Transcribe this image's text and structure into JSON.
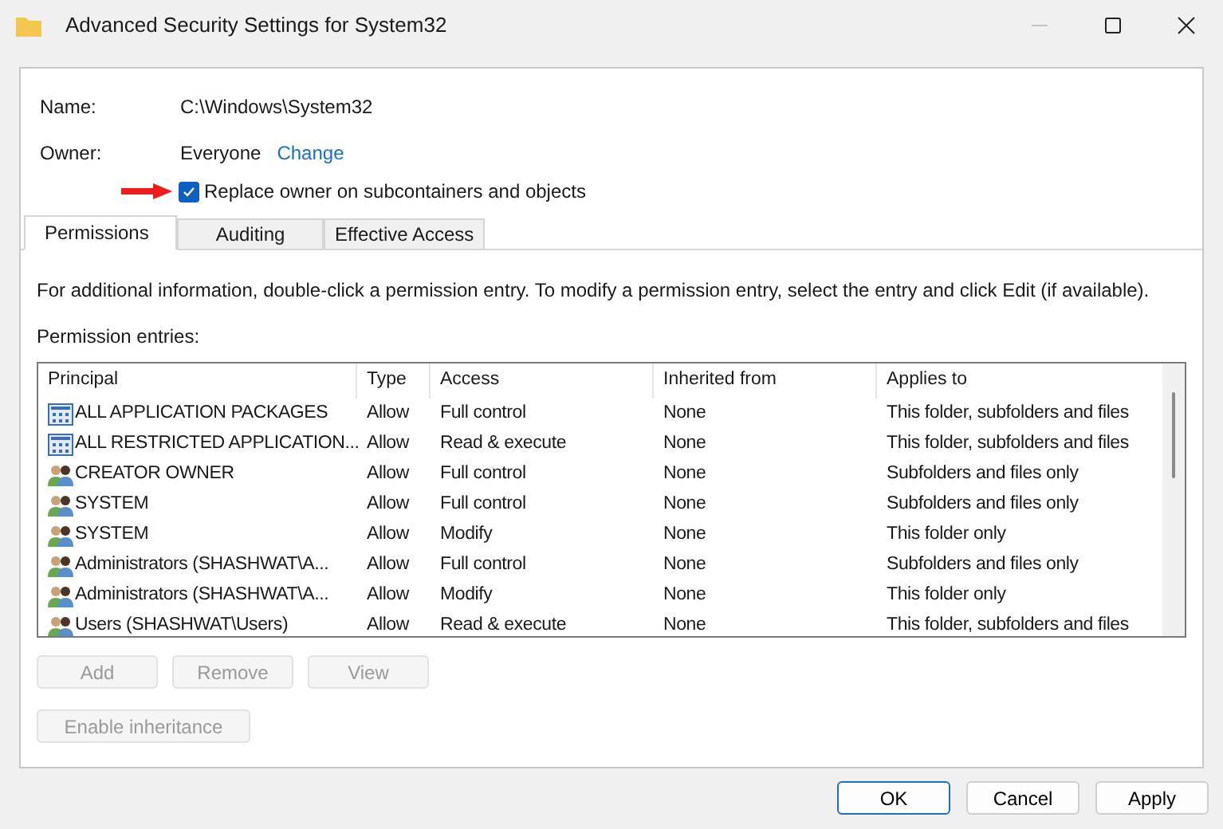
{
  "window": {
    "title": "Advanced Security Settings for System32"
  },
  "name": {
    "label": "Name:",
    "value": "C:\\Windows\\System32"
  },
  "owner": {
    "label": "Owner:",
    "value": "Everyone",
    "link": "Change"
  },
  "replace_owner": {
    "label": "Replace owner on subcontainers and objects",
    "checked": true
  },
  "tabs": [
    {
      "label": "Permissions",
      "selected": true
    },
    {
      "label": "Auditing",
      "selected": false
    },
    {
      "label": "Effective Access",
      "selected": false
    }
  ],
  "info": "For additional information, double-click a permission entry. To modify a permission entry, select the entry and click Edit (if available).",
  "entries_label": "Permission entries:",
  "table": {
    "columns": [
      "Principal",
      "Type",
      "Access",
      "Inherited from",
      "Applies to"
    ],
    "rows": [
      {
        "kind": "package",
        "cells": [
          "ALL APPLICATION PACKAGES",
          "Allow",
          "Full control",
          "None",
          "This folder, subfolders and files"
        ]
      },
      {
        "kind": "package",
        "cells": [
          "ALL RESTRICTED APPLICATION...",
          "Allow",
          "Read & execute",
          "None",
          "This folder, subfolders and files"
        ]
      },
      {
        "kind": "group",
        "cells": [
          "CREATOR OWNER",
          "Allow",
          "Full control",
          "None",
          "Subfolders and files only"
        ]
      },
      {
        "kind": "group",
        "cells": [
          "SYSTEM",
          "Allow",
          "Full control",
          "None",
          "Subfolders and files only"
        ]
      },
      {
        "kind": "group",
        "cells": [
          "SYSTEM",
          "Allow",
          "Modify",
          "None",
          "This folder only"
        ]
      },
      {
        "kind": "group",
        "cells": [
          "Administrators (SHASHWAT\\A...",
          "Allow",
          "Full control",
          "None",
          "Subfolders and files only"
        ]
      },
      {
        "kind": "group",
        "cells": [
          "Administrators (SHASHWAT\\A...",
          "Allow",
          "Modify",
          "None",
          "This folder only"
        ]
      },
      {
        "kind": "group",
        "cells": [
          "Users (SHASHWAT\\Users)",
          "Allow",
          "Read & execute",
          "None",
          "This folder, subfolders and files"
        ]
      }
    ]
  },
  "entry_buttons": [
    {
      "label": "Add",
      "disabled": true
    },
    {
      "label": "Remove",
      "disabled": true
    },
    {
      "label": "View",
      "disabled": true
    }
  ],
  "inheritance_button": {
    "label": "Enable inheritance",
    "disabled": true
  },
  "footer_buttons": [
    {
      "label": "OK",
      "default": true
    },
    {
      "label": "Cancel",
      "default": false
    },
    {
      "label": "Apply",
      "default": false
    }
  ]
}
